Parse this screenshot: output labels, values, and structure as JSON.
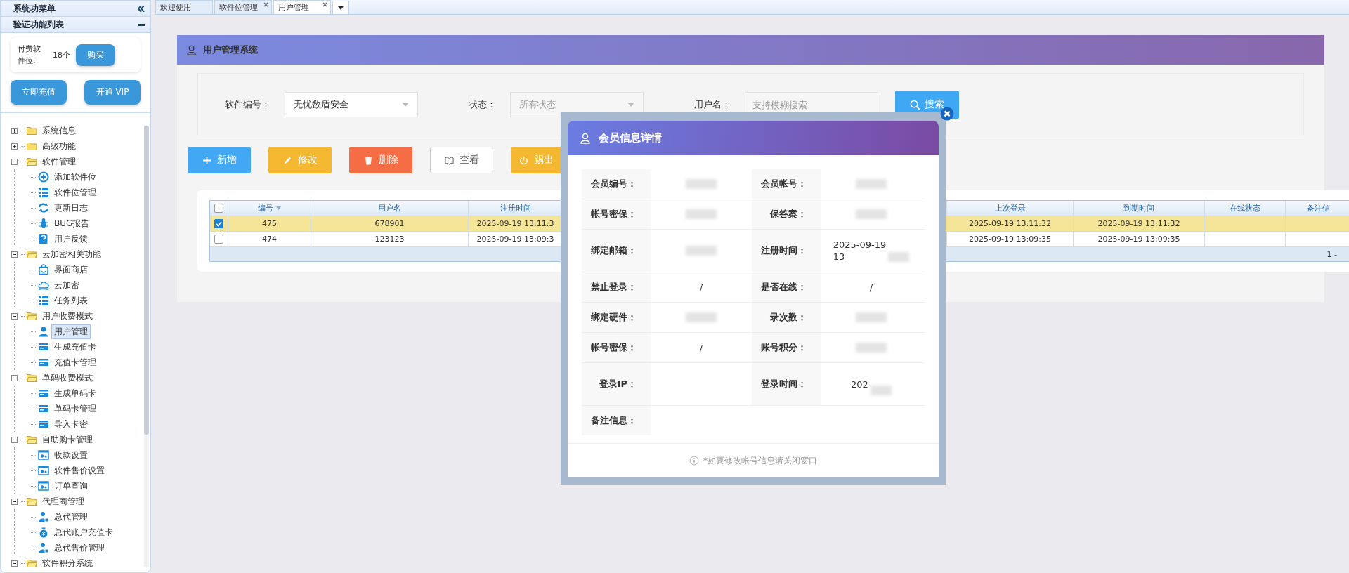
{
  "sidebar": {
    "title": "系统功菜单",
    "section": "验证功能列表",
    "slots": {
      "label": "付费软件位:",
      "count": "18个",
      "button": "购买"
    },
    "actions": [
      "立即充值",
      "开通 VIP"
    ],
    "tree": [
      {
        "label": "系统信息",
        "expanded": false
      },
      {
        "label": "高级功能",
        "expanded": false
      },
      {
        "label": "软件管理",
        "expanded": true,
        "children": [
          {
            "label": "添加软件位",
            "selected": false
          },
          {
            "label": "软件位管理",
            "selected": false
          },
          {
            "label": "更新日志",
            "selected": false
          },
          {
            "label": "BUG报告",
            "selected": false
          },
          {
            "label": "用户反馈",
            "selected": false
          }
        ]
      },
      {
        "label": "云加密相关功能",
        "expanded": true,
        "children": [
          {
            "label": "界面商店",
            "selected": false
          },
          {
            "label": "云加密",
            "selected": false
          },
          {
            "label": "任务列表",
            "selected": false
          }
        ]
      },
      {
        "label": "用户收费模式",
        "expanded": true,
        "children": [
          {
            "label": "用户管理",
            "selected": true
          },
          {
            "label": "生成充值卡",
            "selected": false
          },
          {
            "label": "充值卡管理",
            "selected": false
          }
        ]
      },
      {
        "label": "单码收费模式",
        "expanded": true,
        "children": [
          {
            "label": "生成单码卡",
            "selected": false
          },
          {
            "label": "单码卡管理",
            "selected": false
          },
          {
            "label": "导入卡密",
            "selected": false
          }
        ]
      },
      {
        "label": "自助购卡管理",
        "expanded": true,
        "children": [
          {
            "label": "收款设置",
            "selected": false
          },
          {
            "label": "软件售价设置",
            "selected": false
          },
          {
            "label": "订单查询",
            "selected": false
          }
        ]
      },
      {
        "label": "代理商管理",
        "expanded": true,
        "children": [
          {
            "label": "总代管理",
            "selected": false
          },
          {
            "label": "总代账户充值卡",
            "selected": false
          },
          {
            "label": "总代售价管理",
            "selected": false
          }
        ]
      },
      {
        "label": "软件积分系统",
        "expanded": true
      }
    ]
  },
  "tabs": [
    {
      "label": "欢迎使用",
      "closable": false,
      "selected": false
    },
    {
      "label": "软件位管理",
      "closable": true,
      "selected": false
    },
    {
      "label": "用户管理",
      "closable": true,
      "selected": true
    }
  ],
  "panel": {
    "title": "用户管理系统",
    "filters": [
      {
        "label": "软件编号：",
        "kind": "select",
        "value": "无忧数盾安全"
      },
      {
        "label": "状态：",
        "kind": "select",
        "placeholder": "所有状态"
      },
      {
        "label": "用户名：",
        "kind": "input",
        "placeholder": "支持模糊搜索"
      }
    ],
    "search_button": "搜索",
    "toolbar": [
      {
        "label": "新增",
        "kind": "add"
      },
      {
        "label": "修改",
        "kind": "edit"
      },
      {
        "label": "删除",
        "kind": "delete"
      },
      {
        "label": "查看",
        "kind": "view"
      },
      {
        "label": "踢出",
        "kind": "kick"
      }
    ],
    "table": {
      "all_selected": false,
      "columns": [
        "编号",
        "用户名",
        "注册时间",
        "",
        "上次登录",
        "到期时间",
        "在线状态",
        "备注信"
      ],
      "rows": [
        {
          "selected": true,
          "cells": [
            "475",
            "678901",
            "2025-09-19 13:11:3",
            "",
            "2025-09-19 13:11:32",
            "2025-09-19 13:11:32",
            "",
            ""
          ]
        },
        {
          "selected": false,
          "cells": [
            "474",
            "123123",
            "2025-09-19 13:09:3",
            "",
            "2025-09-19 13:09:35",
            "2025-09-19 13:09:35",
            "",
            ""
          ]
        }
      ],
      "pager": "1 -"
    }
  },
  "modal": {
    "title": "会员信息详情",
    "rows": [
      [
        {
          "label": "会员编号：",
          "value": {
            "blurred": true
          }
        },
        {
          "label": "会员帐号：",
          "value": {
            "blurred": true
          }
        }
      ],
      [
        {
          "label": "帐号密保：",
          "value": {
            "blurred": true
          }
        },
        {
          "label": "保答案：",
          "value": {
            "blurred": true
          }
        }
      ],
      [
        {
          "label": "绑定邮箱：",
          "value": {
            "blurred": true
          }
        },
        {
          "label": "注册时间：",
          "value": {
            "lines": [
              "2025-09-19",
              "13"
            ],
            "blurred": true
          }
        }
      ],
      [
        {
          "label": "禁止登录：",
          "value": {
            "lines": [
              "/"
            ]
          }
        },
        {
          "label": "是否在线：",
          "value": {
            "lines": [
              "/"
            ]
          }
        }
      ],
      [
        {
          "label": "绑定硬件：",
          "value": {
            "blurred": true
          }
        },
        {
          "label": "录次数：",
          "value": {
            "blurred": true
          }
        }
      ],
      [
        {
          "label": "帐号密保：",
          "value": {
            "lines": [
              "/"
            ]
          }
        },
        {
          "label": "账号积分：",
          "value": {
            "blurred": true
          }
        }
      ],
      [
        {
          "label": "登录IP："
        },
        {
          "label": "登录时间：",
          "value": {
            "lines": [
              "202"
            ],
            "blurred": true
          }
        }
      ],
      [
        {
          "label": "备注信息："
        }
      ]
    ],
    "note": "*如要修改帐号信息请关闭窗口"
  }
}
